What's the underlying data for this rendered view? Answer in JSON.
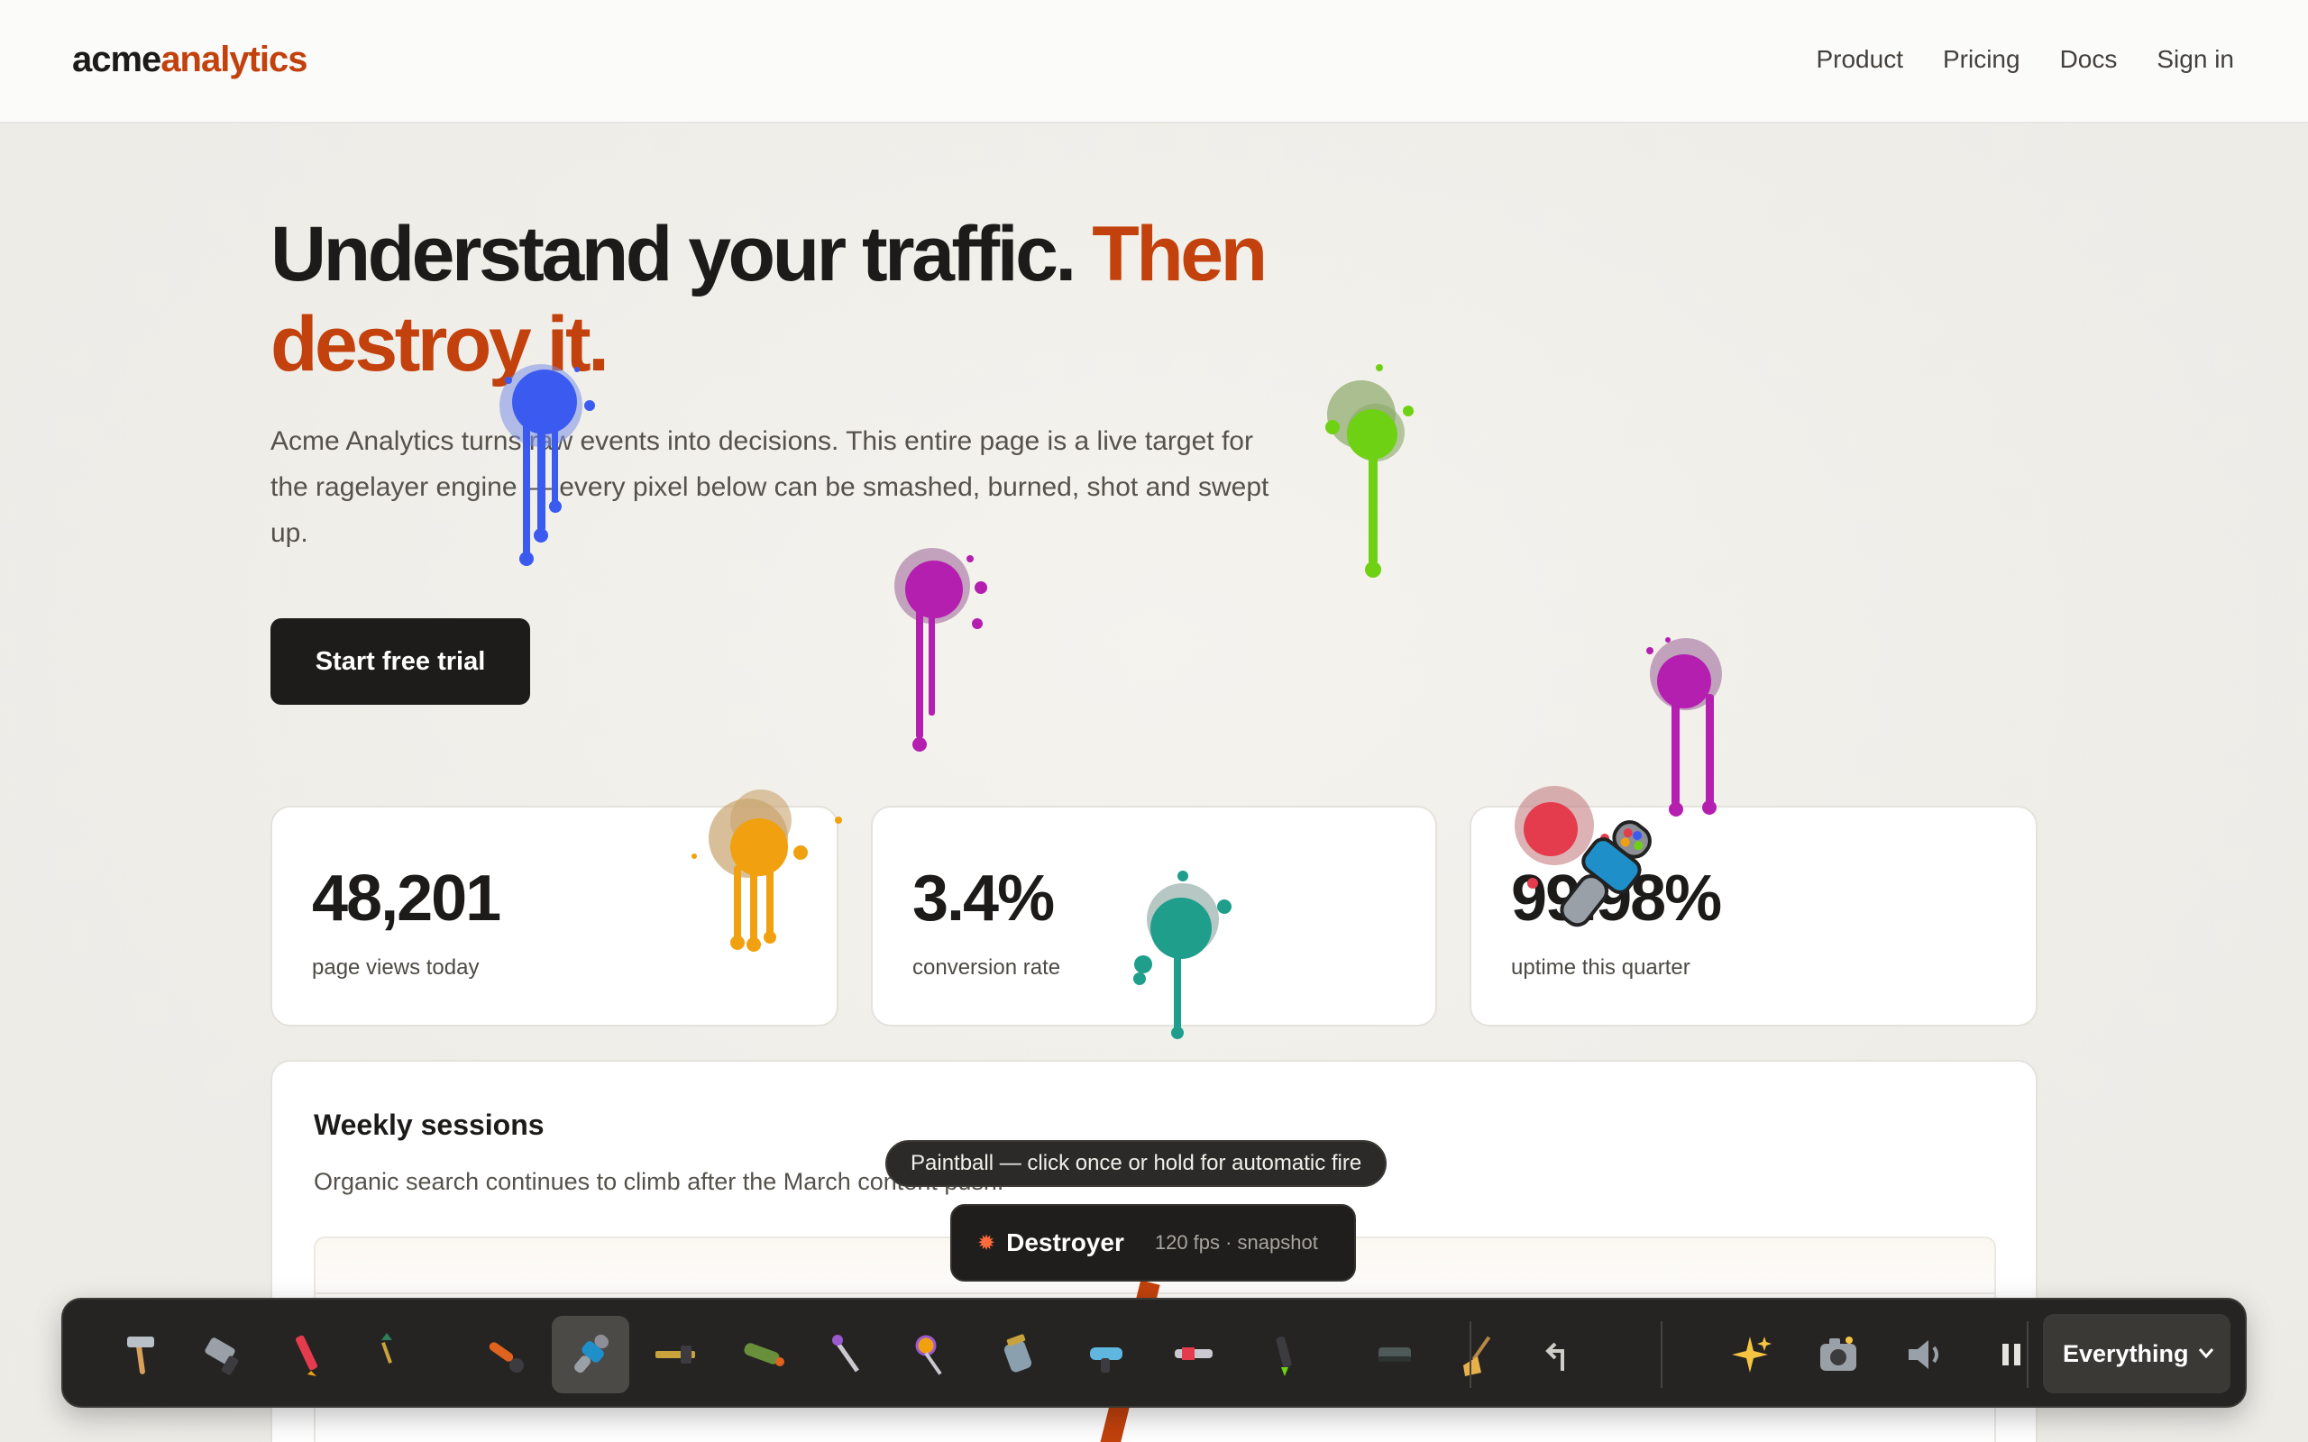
{
  "header": {
    "logo_part1": "acme",
    "logo_part2": "analytics",
    "nav": [
      "Product",
      "Pricing",
      "Docs",
      "Sign in"
    ]
  },
  "hero": {
    "headline_part1": "Understand your traffic.",
    "headline_accent": "Then destroy it.",
    "lede": "Acme Analytics turns raw events into decisions. This entire page is a live target for the ragelayer engine — every pixel below can be smashed, burned, shot and swept up.",
    "cta_label": "Start free trial"
  },
  "stats": [
    {
      "value": "48,201",
      "label": "page views today"
    },
    {
      "value": "3.4%",
      "label": "conversion rate"
    },
    {
      "value": "99.98%",
      "label": "uptime this quarter"
    }
  ],
  "sessions": {
    "title": "Weekly sessions",
    "subtitle": "Organic search continues to climb after the March content push."
  },
  "tooltip": "Paintball — click once or hold for automatic fire",
  "hud": {
    "icon": "explosion-icon",
    "title": "Destroyer",
    "meta": "120 fps · snapshot"
  },
  "toolbar": {
    "tools": [
      "hammer-icon",
      "chainsaw-icon",
      "crayon-icon",
      "dart-icon",
      "torch-icon",
      "paintball-gun-icon",
      "rifle-icon",
      "rocket-launcher-icon",
      "magic-wand-icon",
      "lollipop-icon",
      "jar-icon",
      "ray-gun-icon",
      "blaster-icon",
      "marker-icon",
      "eraser-icon",
      "broom-icon",
      "undo-icon",
      "sparkles-icon",
      "camera-icon",
      "speaker-icon",
      "pause-icon"
    ],
    "active_tool": "paintball-gun-icon",
    "target_selector": "Everything"
  },
  "colors": {
    "accent": "#c2410c",
    "paint_blue": "#3b5bf0",
    "paint_green": "#6fd114",
    "paint_magenta": "#b51fb0",
    "paint_orange": "#f1a10f",
    "paint_teal": "#1f9e8c",
    "paint_red": "#e43b4d"
  }
}
